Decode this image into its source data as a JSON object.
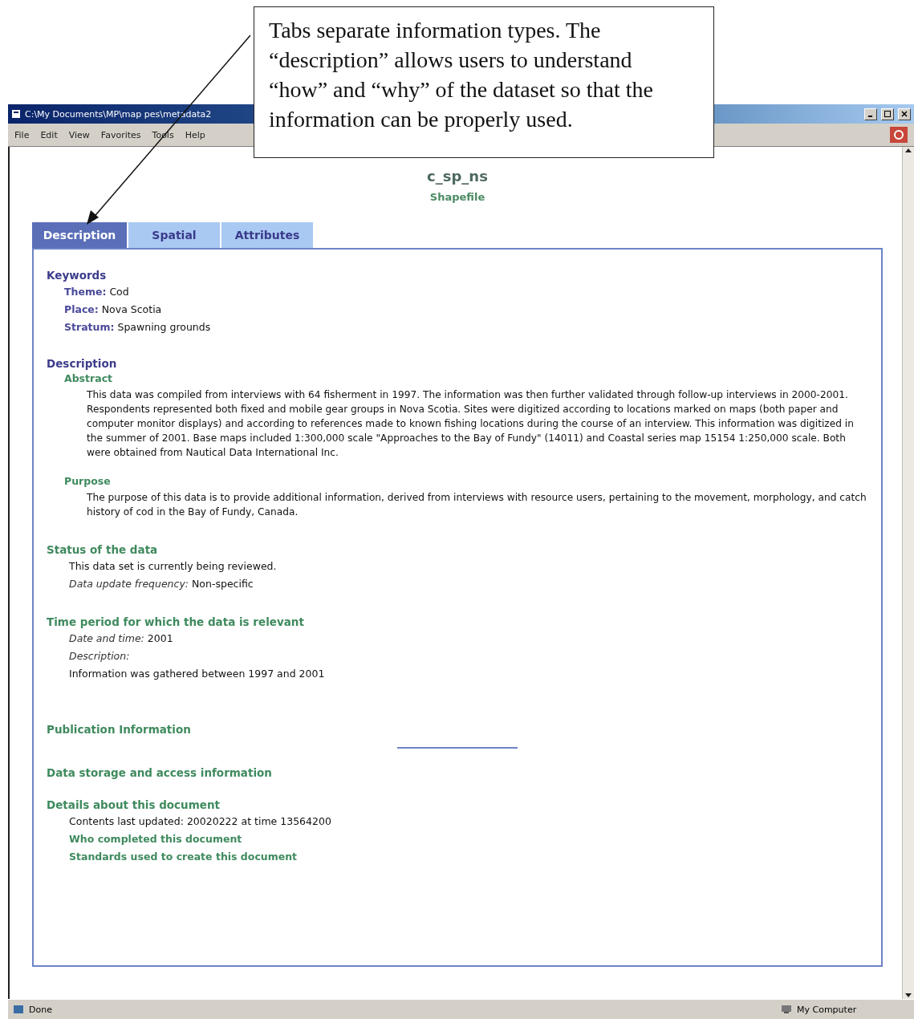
{
  "annotation": {
    "text": "Tabs separate information types. The “description” allows users to understand “how” and “why” of the dataset so that the information can be properly used."
  },
  "window": {
    "title": "C:\\My Documents\\MP\\map pes\\metadata2",
    "menu": [
      "File",
      "Edit",
      "View",
      "Favorites",
      "Tools",
      "Help"
    ]
  },
  "page": {
    "title": "c_sp_ns",
    "subtitle": "Shapefile"
  },
  "tabs": [
    {
      "label": "Description",
      "selected": true
    },
    {
      "label": "Spatial",
      "selected": false
    },
    {
      "label": "Attributes",
      "selected": false
    }
  ],
  "keywords": {
    "heading": "Keywords",
    "items": [
      {
        "label": "Theme:",
        "value": "Cod"
      },
      {
        "label": "Place:",
        "value": "Nova Scotia"
      },
      {
        "label": "Stratum:",
        "value": "Spawning grounds"
      }
    ]
  },
  "description": {
    "heading": "Description",
    "parts": [
      {
        "heading": "Abstract",
        "text": "This data was compiled from interviews with 64 fisherment in 1997. The information was then further validated through follow-up interviews in 2000-2001. Respondents represented both fixed and mobile gear groups in Nova Scotia. Sites were digitized according to locations marked on maps (both paper and computer monitor displays) and according to references made to known fishing locations during the course of an interview. This information was digitized in the summer of 2001. Base maps included 1:300,000 scale \"Approaches to the Bay of Fundy\" (14011) and Coastal series map 15154 1:250,000 scale.  Both were obtained from Nautical Data International Inc."
      },
      {
        "heading": "Purpose",
        "text": "The purpose of this data is to provide additional information, derived from interviews with resource users, pertaining to the movement, morphology, and catch history of cod in the Bay of Fundy, Canada."
      }
    ]
  },
  "sections": [
    {
      "heading": "Status of the data",
      "lines": [
        {
          "kind": "plain",
          "text": "This data set is currently being reviewed."
        },
        {
          "kind": "field",
          "label": "Data update frequency:",
          "value": "Non-specific"
        }
      ]
    },
    {
      "heading": "Time period for which the data is relevant",
      "lines": [
        {
          "kind": "field",
          "label": "Date and time:",
          "value": "2001"
        },
        {
          "kind": "label",
          "text": "Description:"
        },
        {
          "kind": "plain",
          "text": "Information was gathered between 1997 and 2001"
        }
      ]
    },
    {
      "heading": "Publication Information"
    },
    {
      "heading": "Data storage and access information"
    },
    {
      "heading": "Details about this document",
      "lines": [
        {
          "kind": "plain",
          "text": "Contents last updated: 20020222 at time 13564200"
        },
        {
          "kind": "link",
          "text": "Who completed this document"
        },
        {
          "kind": "link",
          "text": "Standards used to create this document"
        }
      ]
    }
  ],
  "status_bar": {
    "text": "Done",
    "zone": "My Computer"
  }
}
